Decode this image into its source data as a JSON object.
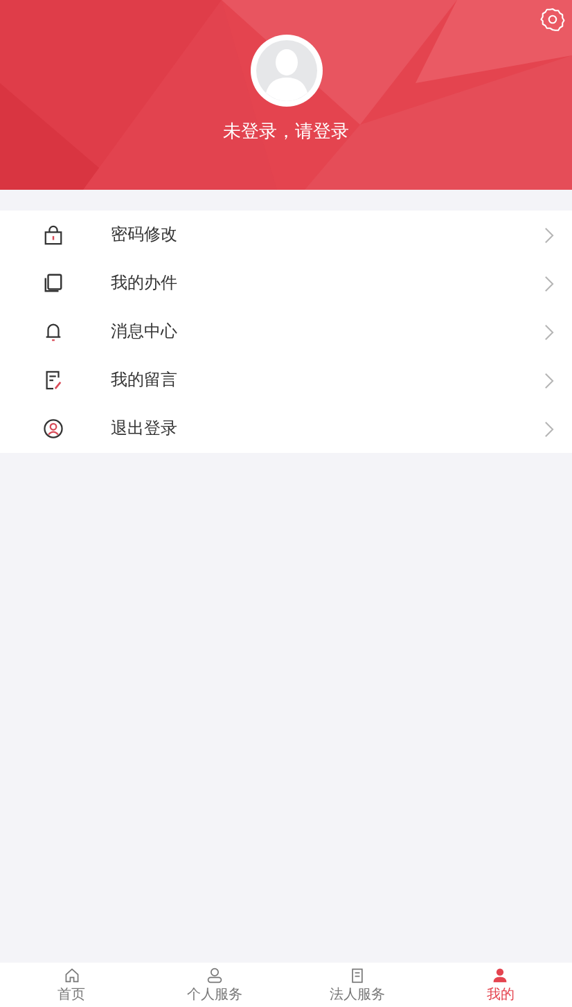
{
  "profile": {
    "login_prompt": "未登录，请登录"
  },
  "menu": [
    {
      "label": "密码修改",
      "kind": "lock"
    },
    {
      "label": "我的办件",
      "kind": "files"
    },
    {
      "label": "消息中心",
      "kind": "bell"
    },
    {
      "label": "我的留言",
      "kind": "note"
    },
    {
      "label": "退出登录",
      "kind": "user"
    }
  ],
  "tab_bar": [
    {
      "label": "首页",
      "kind": "home",
      "selected": false
    },
    {
      "label": "个人服务",
      "kind": "person",
      "selected": false
    },
    {
      "label": "法人服务",
      "kind": "building",
      "selected": false
    },
    {
      "label": "我的",
      "kind": "mine",
      "selected": true
    }
  ]
}
